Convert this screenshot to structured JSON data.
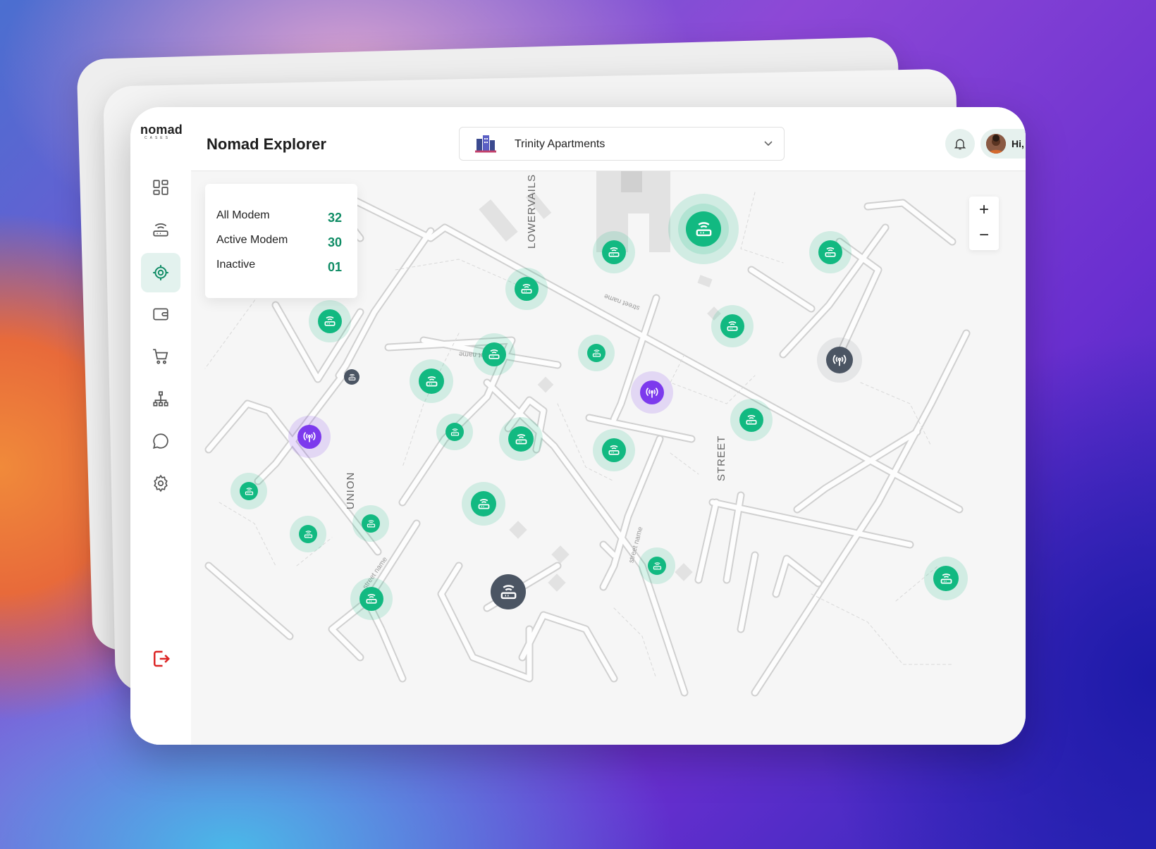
{
  "app": {
    "brand": "nomad",
    "brand_sub": "CASES"
  },
  "header": {
    "title": "Nomad Explorer",
    "building_select": "Trinity Apartments",
    "greeting": "Hi, Ruth"
  },
  "sidebar": {
    "items": [
      {
        "name": "dashboard",
        "icon": "dashboard-icon"
      },
      {
        "name": "modems",
        "icon": "router-icon"
      },
      {
        "name": "explorer",
        "icon": "target-icon",
        "active": true
      },
      {
        "name": "wallet",
        "icon": "wallet-icon"
      },
      {
        "name": "cart",
        "icon": "cart-icon"
      },
      {
        "name": "network",
        "icon": "hierarchy-icon"
      },
      {
        "name": "messages",
        "icon": "chat-icon"
      },
      {
        "name": "settings",
        "icon": "gear-icon"
      }
    ],
    "logout_icon": "logout-icon"
  },
  "stats": {
    "all_label": "All Modem",
    "all_value": "32",
    "active_label": "Active Modem",
    "active_value": "30",
    "inactive_label": "Inactive",
    "inactive_value": "01"
  },
  "map": {
    "streets": {
      "lowervails": "LOWERVAILS",
      "union": "UNION",
      "street": "STREET",
      "street_name": "street name"
    },
    "zoom_in": "+",
    "zoom_out": "−"
  },
  "colors": {
    "accent": "#12b981",
    "accent_dark": "#0f8c65",
    "inactive": "#4b5563",
    "tower": "#7c3aed",
    "logout": "#dc2626"
  }
}
